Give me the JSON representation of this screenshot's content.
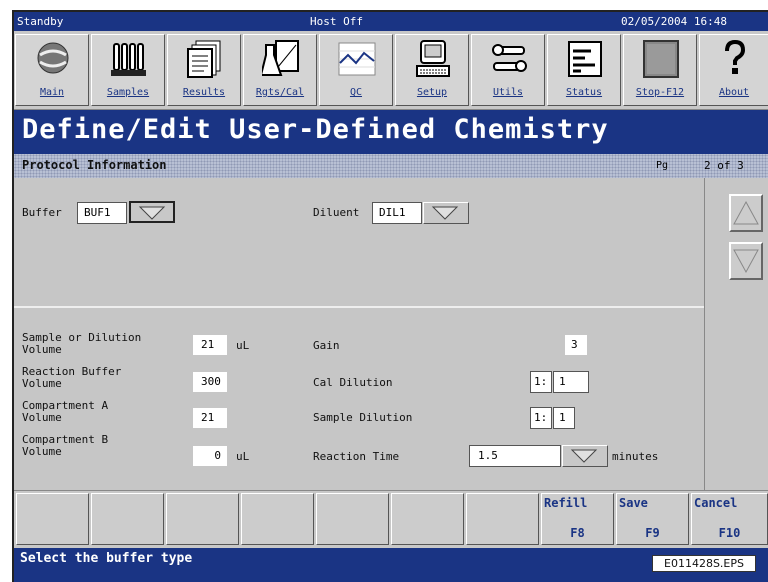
{
  "status_bar": {
    "mode": "Standby",
    "host": "Host Off",
    "datetime": "02/05/2004 16:48"
  },
  "toolbar": [
    {
      "label": "Main",
      "icon": "globe-icon"
    },
    {
      "label": "Samples",
      "icon": "test-tubes-icon"
    },
    {
      "label": "Results",
      "icon": "documents-icon"
    },
    {
      "label": "Rgts/Cal",
      "icon": "flask-chart-icon"
    },
    {
      "label": "QC",
      "icon": "qc-graph-icon"
    },
    {
      "label": "Setup",
      "icon": "computer-icon"
    },
    {
      "label": "Utils",
      "icon": "tools-icon"
    },
    {
      "label": "Status",
      "icon": "status-panel-icon"
    },
    {
      "label": "Stop-F12",
      "icon": "stop-square-icon"
    },
    {
      "label": "About",
      "icon": "question-icon"
    }
  ],
  "title": "Define/Edit User-Defined Chemistry",
  "section": {
    "title": "Protocol Information",
    "pg_label": "Pg",
    "pg_value": "2 of 3"
  },
  "buffer": {
    "label": "Buffer",
    "value": "BUF1"
  },
  "diluent": {
    "label": "Diluent",
    "value": "DIL1"
  },
  "left_fields": [
    {
      "label": "Sample or Dilution\nVolume",
      "value": "21",
      "unit": "uL"
    },
    {
      "label": "Reaction Buffer\nVolume",
      "value": "300",
      "unit": ""
    },
    {
      "label": "Compartment A\nVolume",
      "value": "21",
      "unit": ""
    },
    {
      "label": "Compartment B\nVolume",
      "value": "0",
      "unit": "uL"
    }
  ],
  "gain": {
    "label": "Gain",
    "value": "3"
  },
  "cal_dilution": {
    "label": "Cal Dilution",
    "prefix": "1:",
    "value": "1"
  },
  "sample_dilution": {
    "label": "Sample Dilution",
    "prefix": "1:",
    "value": "1"
  },
  "reaction_time": {
    "label": "Reaction Time",
    "value": "1.5",
    "unit": "minutes"
  },
  "function_keys": [
    {
      "line1": "",
      "line2": ""
    },
    {
      "line1": "",
      "line2": ""
    },
    {
      "line1": "",
      "line2": ""
    },
    {
      "line1": "",
      "line2": ""
    },
    {
      "line1": "",
      "line2": ""
    },
    {
      "line1": "",
      "line2": ""
    },
    {
      "line1": "",
      "line2": ""
    },
    {
      "line1": "Refill",
      "line2": "F8"
    },
    {
      "line1": "Save",
      "line2": "F9"
    },
    {
      "line1": "Cancel",
      "line2": "F10"
    }
  ],
  "message": "Select the buffer type",
  "figure_tag": "E011428S.EPS"
}
